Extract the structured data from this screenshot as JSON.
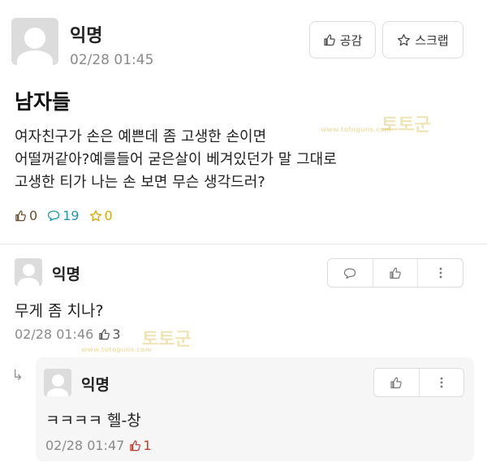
{
  "post": {
    "author": "익명",
    "time": "02/28 01:45",
    "like_button": "공감",
    "scrap_button": "스크랩",
    "title": "남자들",
    "body_lines": [
      "여자친구가 손은 예쁜데 좀 고생한 손이면",
      "어떨꺼같아?예를들어 굳은살이 베겨있던가 말 그대로",
      "고생한 티가 나는 손 보면 무슨 생각드러?"
    ],
    "stats": {
      "likes": "0",
      "comments": "19",
      "scraps": "0"
    }
  },
  "comment": {
    "author": "익명",
    "text": "무게 좀 치나?",
    "time": "02/28 01:46",
    "likes": "3"
  },
  "reply": {
    "author": "익명",
    "text": "ㅋㅋㅋㅋ 헬-창",
    "time": "02/28 01:47",
    "likes": "1"
  },
  "watermark": {
    "text": "토토군",
    "url": "www.totoguns.com"
  },
  "colors": {
    "like": "#6b4a2a",
    "comment": "#1a9aa8",
    "scrap": "#d4a800",
    "reply_like": "#c0392b"
  }
}
